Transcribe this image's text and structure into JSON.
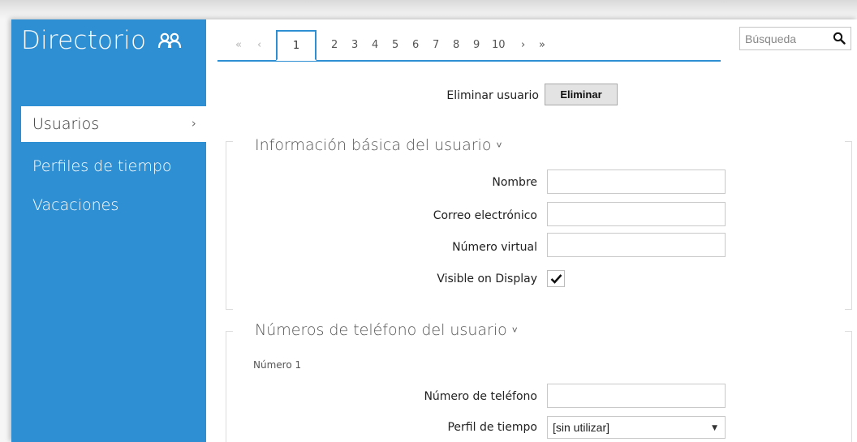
{
  "sidebar": {
    "title": "Directorio",
    "title_icon": "users-icon",
    "items": [
      {
        "label": "Usuarios",
        "active": true
      },
      {
        "label": "Perfiles de tiempo",
        "active": false
      },
      {
        "label": "Vacaciones",
        "active": false
      }
    ]
  },
  "pagination": {
    "first": "«",
    "prev": "‹",
    "pages": [
      "1",
      "2",
      "3",
      "4",
      "5",
      "6",
      "7",
      "8",
      "9",
      "10"
    ],
    "active_page": "1",
    "next": "›",
    "last": "»"
  },
  "search": {
    "placeholder": "Búsqueda",
    "icon": "search-icon"
  },
  "delete_user": {
    "label": "Eliminar usuario",
    "button": "Eliminar"
  },
  "basic_info": {
    "title": "Información básica del usuario",
    "fields": [
      {
        "label": "Nombre",
        "value": ""
      },
      {
        "label": "Correo electrónico",
        "value": ""
      },
      {
        "label": "Número virtual",
        "value": ""
      }
    ],
    "visible_on_display": {
      "label": "Visible on Display",
      "checked": true
    }
  },
  "phone_numbers": {
    "title": "Números de teléfono del usuario",
    "number_label": "Número 1",
    "phone_field": {
      "label": "Número de teléfono",
      "value": ""
    },
    "time_profile": {
      "label": "Perfil de tiempo",
      "selected": "[sin utilizar]"
    }
  },
  "colors": {
    "accent": "#2f8fd3",
    "sidebar_text": "#ffffff",
    "button_bg": "#e3e3e3"
  }
}
